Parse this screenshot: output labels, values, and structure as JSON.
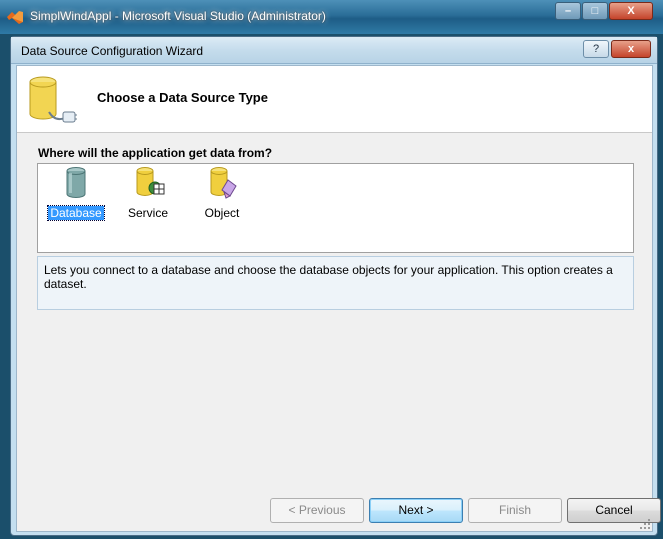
{
  "vs_window": {
    "title": "SimplWindAppl - Microsoft Visual Studio (Administrator)",
    "controls": {
      "minimize": "–",
      "maximize": "□",
      "close": "X"
    }
  },
  "dialog": {
    "title": "Data Source Configuration Wizard",
    "controls": {
      "help": "?",
      "close": "x"
    },
    "header_title": "Choose a Data Source Type",
    "question": "Where will the application get data from?",
    "choices": [
      {
        "label": "Database",
        "icon": "database-icon",
        "selected": true
      },
      {
        "label": "Service",
        "icon": "service-icon",
        "selected": false
      },
      {
        "label": "Object",
        "icon": "object-icon",
        "selected": false
      }
    ],
    "description": "Lets you connect to a database and choose the database objects for your application. This option creates a dataset.",
    "buttons": {
      "previous": "< Previous",
      "next": "Next >",
      "finish": "Finish",
      "cancel": "Cancel"
    },
    "colors": {
      "selection": "#3399ff",
      "client_bg": "#f0f0f0",
      "frame": "#c4dff0"
    }
  }
}
